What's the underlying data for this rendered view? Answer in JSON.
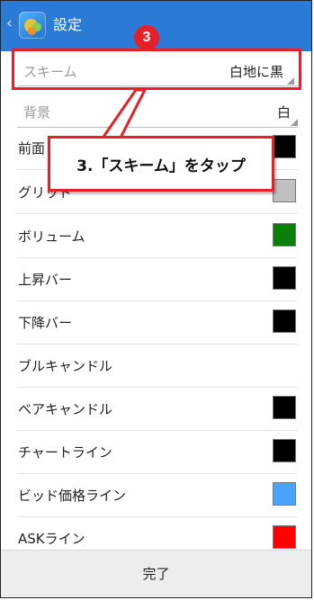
{
  "appbar": {
    "back_glyph": "‹",
    "title": "設定"
  },
  "scheme": {
    "label": "スキーム",
    "value": "白地に黒"
  },
  "background": {
    "label": "背景",
    "value": "白"
  },
  "color_rows": [
    {
      "label": "前面",
      "color": "#000000"
    },
    {
      "label": "グリッド",
      "color": "#c0c0c0"
    },
    {
      "label": "ボリューム",
      "color": "#0a7f0a"
    },
    {
      "label": "上昇バー",
      "color": "#000000"
    },
    {
      "label": "下降バー",
      "color": "#000000"
    },
    {
      "label": "ブルキャンドル",
      "color": null
    },
    {
      "label": "ベアキャンドル",
      "color": "#000000"
    },
    {
      "label": "チャートライン",
      "color": "#000000"
    },
    {
      "label": "ビッド価格ライン",
      "color": "#4aa3ff"
    },
    {
      "label": "ASKライン",
      "color": "#ff0000"
    }
  ],
  "footer": {
    "done_label": "完了"
  },
  "annotation": {
    "step_number": "3",
    "instruction": "3.「スキーム」をタップ",
    "accent_color": "#e52028"
  }
}
